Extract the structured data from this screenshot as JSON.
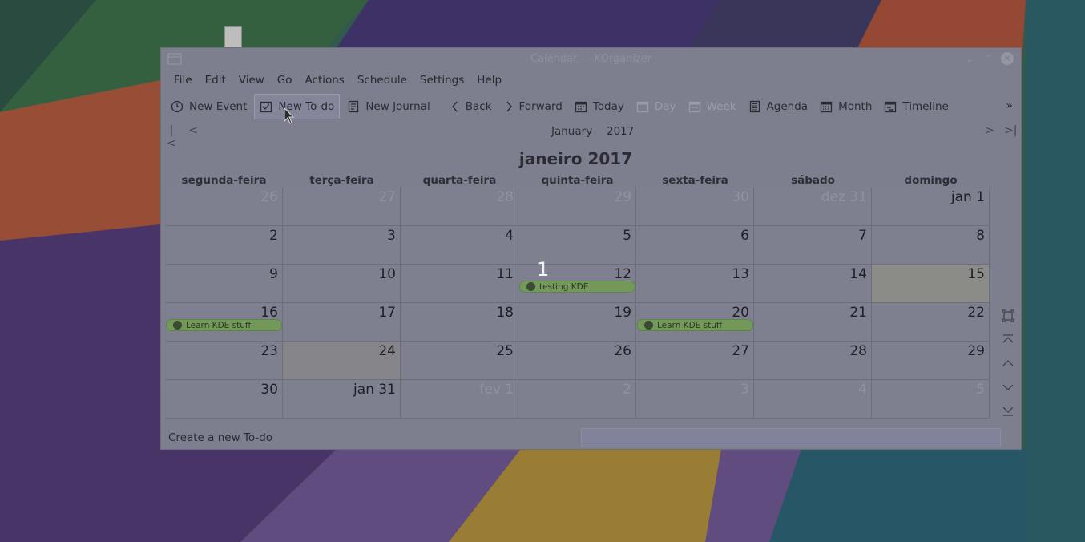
{
  "window": {
    "title": "Calendar — KOrganizer"
  },
  "menu": [
    "File",
    "Edit",
    "View",
    "Go",
    "Actions",
    "Schedule",
    "Settings",
    "Help"
  ],
  "toolbar": {
    "new_event": "New Event",
    "new_todo": "New To-do",
    "new_journal": "New Journal",
    "back": "Back",
    "forward": "Forward",
    "today": "Today",
    "day": "Day",
    "week": "Week",
    "agenda": "Agenda",
    "month": "Month",
    "timeline": "Timeline"
  },
  "nav": {
    "month": "January",
    "year": "2017"
  },
  "calendar": {
    "title": "janeiro 2017",
    "weekdays": [
      "segunda-feira",
      "terça-feira",
      "quarta-feira",
      "quinta-feira",
      "sexta-feira",
      "sábado",
      "domingo"
    ],
    "weeks": [
      [
        "26",
        "27",
        "28",
        "29",
        "30",
        "dez 31",
        "jan 1"
      ],
      [
        "2",
        "3",
        "4",
        "5",
        "6",
        "7",
        "8"
      ],
      [
        "9",
        "10",
        "11",
        "12",
        "13",
        "14",
        "15"
      ],
      [
        "16",
        "17",
        "18",
        "19",
        "20",
        "21",
        "22"
      ],
      [
        "23",
        "24",
        "25",
        "26",
        "27",
        "28",
        "29"
      ],
      [
        "30",
        "jan 31",
        "fev 1",
        "2",
        "3",
        "4",
        "5"
      ]
    ],
    "events": {
      "testing": "testing KDE",
      "learn_1": "Learn KDE stuff",
      "learn_2": "Learn KDE stuff"
    }
  },
  "overlay_count": "1",
  "status": {
    "text": "Create a new To-do"
  },
  "colors": {
    "event_green": "#73995a",
    "window_bg": "#7d7f8e"
  }
}
